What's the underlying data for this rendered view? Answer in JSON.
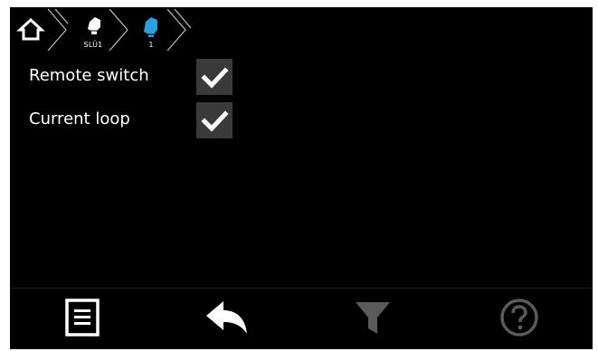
{
  "breadcrumb": {
    "items": [
      {
        "label": "",
        "icon": "home-icon"
      },
      {
        "label": "SLÜ1",
        "icon": "device-icon"
      },
      {
        "label": "1",
        "icon": "device-icon-active"
      }
    ]
  },
  "settings": {
    "rows": [
      {
        "label": "Remote switch",
        "checked": true
      },
      {
        "label": "Current loop",
        "checked": true
      }
    ]
  },
  "toolbar": {
    "buttons": [
      {
        "icon": "list-icon",
        "enabled": true
      },
      {
        "icon": "back-arrow-icon",
        "enabled": true
      },
      {
        "icon": "filter-icon",
        "enabled": false
      },
      {
        "icon": "help-icon",
        "enabled": false
      }
    ]
  },
  "colors": {
    "background": "#000000",
    "active_accent": "#2aa0e0",
    "disabled": "#5a5a5a",
    "checkbox_bg": "#3a3a3a"
  }
}
